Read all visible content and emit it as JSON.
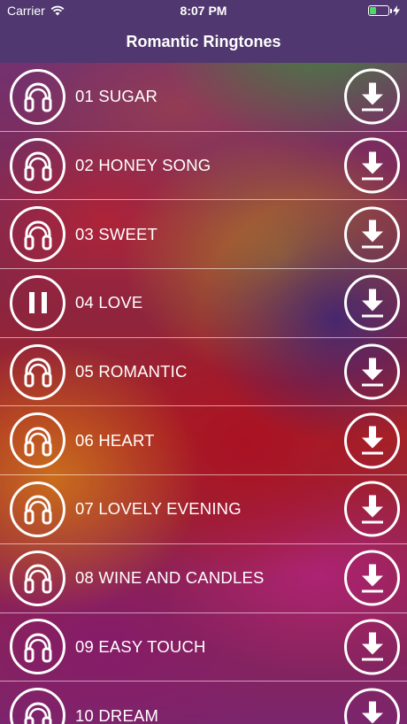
{
  "status_bar": {
    "carrier": "Carrier",
    "time": "8:07 PM",
    "battery_level": 0.35,
    "wifi_icon": "wifi-icon",
    "charging_icon": "bolt-icon"
  },
  "nav": {
    "title": "Romantic Ringtones"
  },
  "colors": {
    "nav_bg": "#50376f",
    "battery_fill": "#4cd964",
    "foreground": "#ffffff"
  },
  "tracks": [
    {
      "title": "01 SUGAR",
      "state": "headphones"
    },
    {
      "title": "02 HONEY SONG",
      "state": "headphones"
    },
    {
      "title": "03 SWEET",
      "state": "headphones"
    },
    {
      "title": "04 LOVE",
      "state": "pause"
    },
    {
      "title": "05 ROMANTIC",
      "state": "headphones"
    },
    {
      "title": "06 HEART",
      "state": "headphones"
    },
    {
      "title": "07 LOVELY EVENING",
      "state": "headphones"
    },
    {
      "title": "08 WINE AND CANDLES",
      "state": "headphones"
    },
    {
      "title": "09 EASY TOUCH",
      "state": "headphones"
    },
    {
      "title": "10 DREAM",
      "state": "headphones"
    }
  ]
}
